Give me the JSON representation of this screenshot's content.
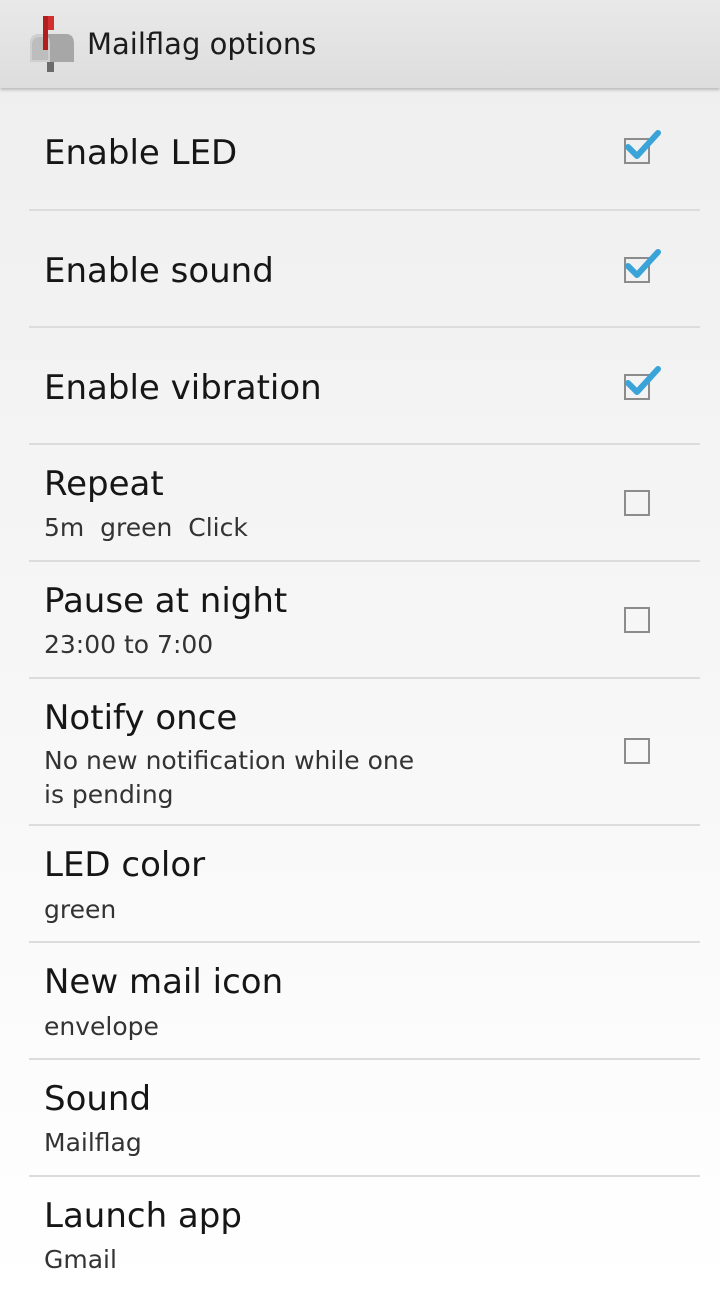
{
  "app_bar": {
    "title": "Mailflag options",
    "icon": "mailbox-icon"
  },
  "accent_color": "#3aa3d8",
  "preferences": [
    {
      "title": "Enable LED",
      "summary": "",
      "widget": "checkbox",
      "checked": true
    },
    {
      "title": "Enable sound",
      "summary": "",
      "widget": "checkbox",
      "checked": true
    },
    {
      "title": "Enable vibration",
      "summary": "",
      "widget": "checkbox",
      "checked": true
    },
    {
      "title": "Repeat",
      "summary": "5m  green  Click",
      "widget": "checkbox",
      "checked": false
    },
    {
      "title": "Pause at night",
      "summary": "23:00 to 7:00",
      "widget": "checkbox",
      "checked": false
    },
    {
      "title": "Notify once",
      "summary": "No new notification while one\nis pending",
      "widget": "checkbox",
      "checked": false
    },
    {
      "title": "LED color",
      "summary": "green"
    },
    {
      "title": "New mail icon",
      "summary": "envelope"
    },
    {
      "title": "Sound",
      "summary": "Mailflag"
    },
    {
      "title": "Launch app",
      "summary": "Gmail"
    }
  ]
}
